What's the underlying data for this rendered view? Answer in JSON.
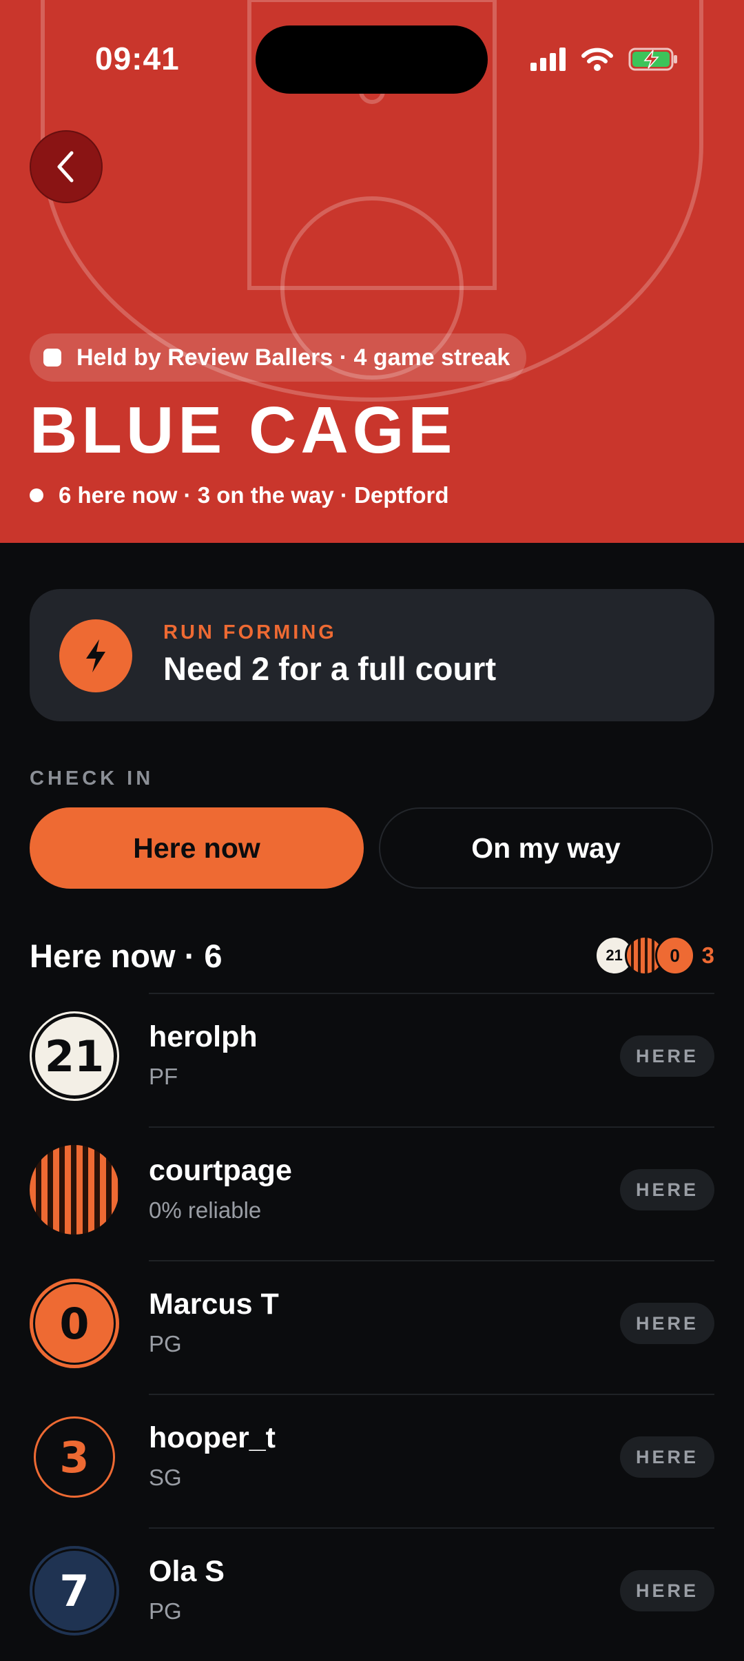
{
  "status": {
    "time": "09:41"
  },
  "court": {
    "holder": "Held by Review Ballers · 4 game streak",
    "name": "BLUE CAGE",
    "meta": "6 here now · 3 on the way · Deptford"
  },
  "run": {
    "label": "RUN FORMING",
    "title": "Need 2 for a full court",
    "icon": "lightning-icon"
  },
  "checkin": {
    "label": "CHECK IN",
    "here_now": "Here now",
    "on_my_way": "On my way"
  },
  "section": {
    "title": "Here now · 6",
    "stack_count": "3",
    "stack_labels": [
      "21",
      "",
      "0"
    ]
  },
  "players": [
    {
      "name": "herolph",
      "sub": "PF",
      "number": "21",
      "badge": "HERE",
      "style": "cream"
    },
    {
      "name": "courtpage",
      "sub": "0% reliable",
      "number": "",
      "badge": "HERE",
      "style": "stripes"
    },
    {
      "name": "Marcus T",
      "sub": "PG",
      "number": "0",
      "badge": "HERE",
      "style": "orange"
    },
    {
      "name": "hooper_t",
      "sub": "SG",
      "number": "3",
      "badge": "HERE",
      "style": "outline"
    },
    {
      "name": "Ola S",
      "sub": "PG",
      "number": "7",
      "badge": "HERE",
      "style": "navy"
    }
  ],
  "colors": {
    "hero": "#c9362c",
    "accent": "#ee6a33",
    "background": "#0b0c0e",
    "card": "#22252b"
  }
}
